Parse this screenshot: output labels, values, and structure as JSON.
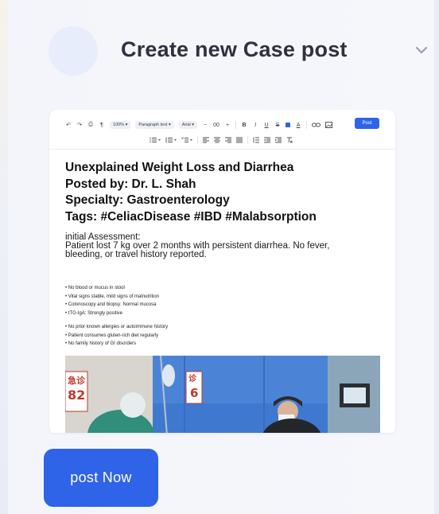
{
  "header": {
    "title": "Create new Case post"
  },
  "toolbar": {
    "undo": "↶",
    "redo": "↷",
    "print": "⎙",
    "paint_format": "¶",
    "zoom": "100%",
    "style": "Paragraph text",
    "font": "Arial",
    "minus": "−",
    "font_size": "00",
    "plus": "+",
    "bold": "B",
    "italic": "I",
    "underline": "U",
    "strike": "S",
    "text_color": "A",
    "post_label": "Post"
  },
  "document": {
    "heading_lines": [
      "Unexplained Weight Loss and Diarrhea",
      "Posted by: Dr. L. Shah",
      "Specialty: Gastroenterology",
      "Tags: #CeliacDisease #IBD #Malabsorption"
    ],
    "section_title": "initial Assessment:",
    "section_body": "Patient lost 7 kg over 2 months with persistent diarrhea. No fever, bleeding, or travel history reported.",
    "bullets_group1": [
      "No blood or mucus in stool",
      "Vital signs stable, mild signs of malnutrition",
      "Colonoscopy and biopsy: Normal mucosa",
      "tTG-IgA: Strongly positive"
    ],
    "bullets_group2": [
      "No prior known allergies or autoimmune history",
      "Patient consumes gluten-rich diet regularly",
      "No family history of GI disorders"
    ],
    "photo_sign_left": "急诊",
    "photo_sign_left_number": "82",
    "photo_sign_right": "诊",
    "photo_sign_right_number": "6"
  },
  "actions": {
    "post_now": "post Now"
  },
  "colors": {
    "primary": "#2f63e8",
    "avatar": "#e7edfb",
    "title": "#2f3140"
  }
}
